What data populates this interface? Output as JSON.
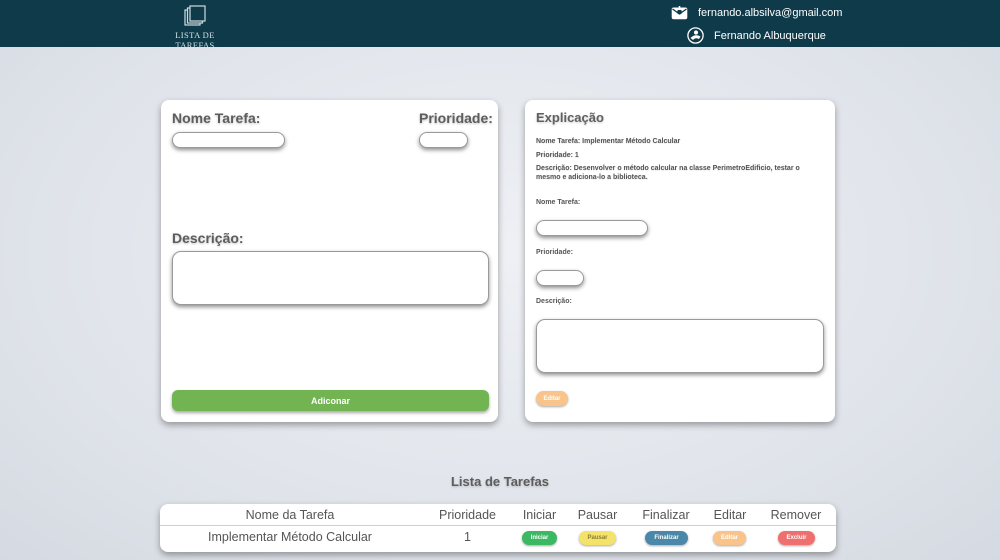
{
  "header": {
    "brand_text": "LISTA DE TAREFAS",
    "brand_icon": "stacked-squares-icon",
    "email": "fernando.albsilva@gmail.com",
    "user_name": "Fernando Albuquerque"
  },
  "form": {
    "name_label": "Nome Tarefa:",
    "priority_label": "Prioridade:",
    "description_label": "Descrição:",
    "name_value": "",
    "priority_value": "",
    "description_value": "",
    "add_button": "Adiconar"
  },
  "explanation": {
    "title": "Explicação",
    "line_name": "Nome Tarefa: Implementar Método Calcular",
    "line_priority": "Prioridade: 1",
    "line_description": "Descrição: Desenvolver o método calcular na classe PerimetroEdificio, testar o mesmo e adiciona-lo a biblioteca.",
    "name_label": "Nome Tarefa:",
    "priority_label": "Prioridade:",
    "description_label": "Descrição:",
    "name_value": "",
    "priority_value": "",
    "description_value": "",
    "edit_button": "Editar"
  },
  "task_list": {
    "title": "Lista de Tarefas",
    "columns": [
      "Nome da Tarefa",
      "Prioridade",
      "Iniciar",
      "Pausar",
      "Finalizar",
      "Editar",
      "Remover"
    ],
    "rows": [
      {
        "name": "Implementar Método Calcular",
        "priority": "1",
        "start_button": "Iniciar",
        "pause_button": "Pausar",
        "finish_button": "Finalizar",
        "edit_button": "Editar",
        "remove_button": "Excluir"
      }
    ]
  },
  "colors": {
    "topbar": "#0e3a4a",
    "add": "#72b451",
    "start": "#3cb863",
    "pause": "#f3e36a",
    "finish": "#4a87a8",
    "edit": "#f9c48a",
    "remove": "#ef6f6f"
  }
}
